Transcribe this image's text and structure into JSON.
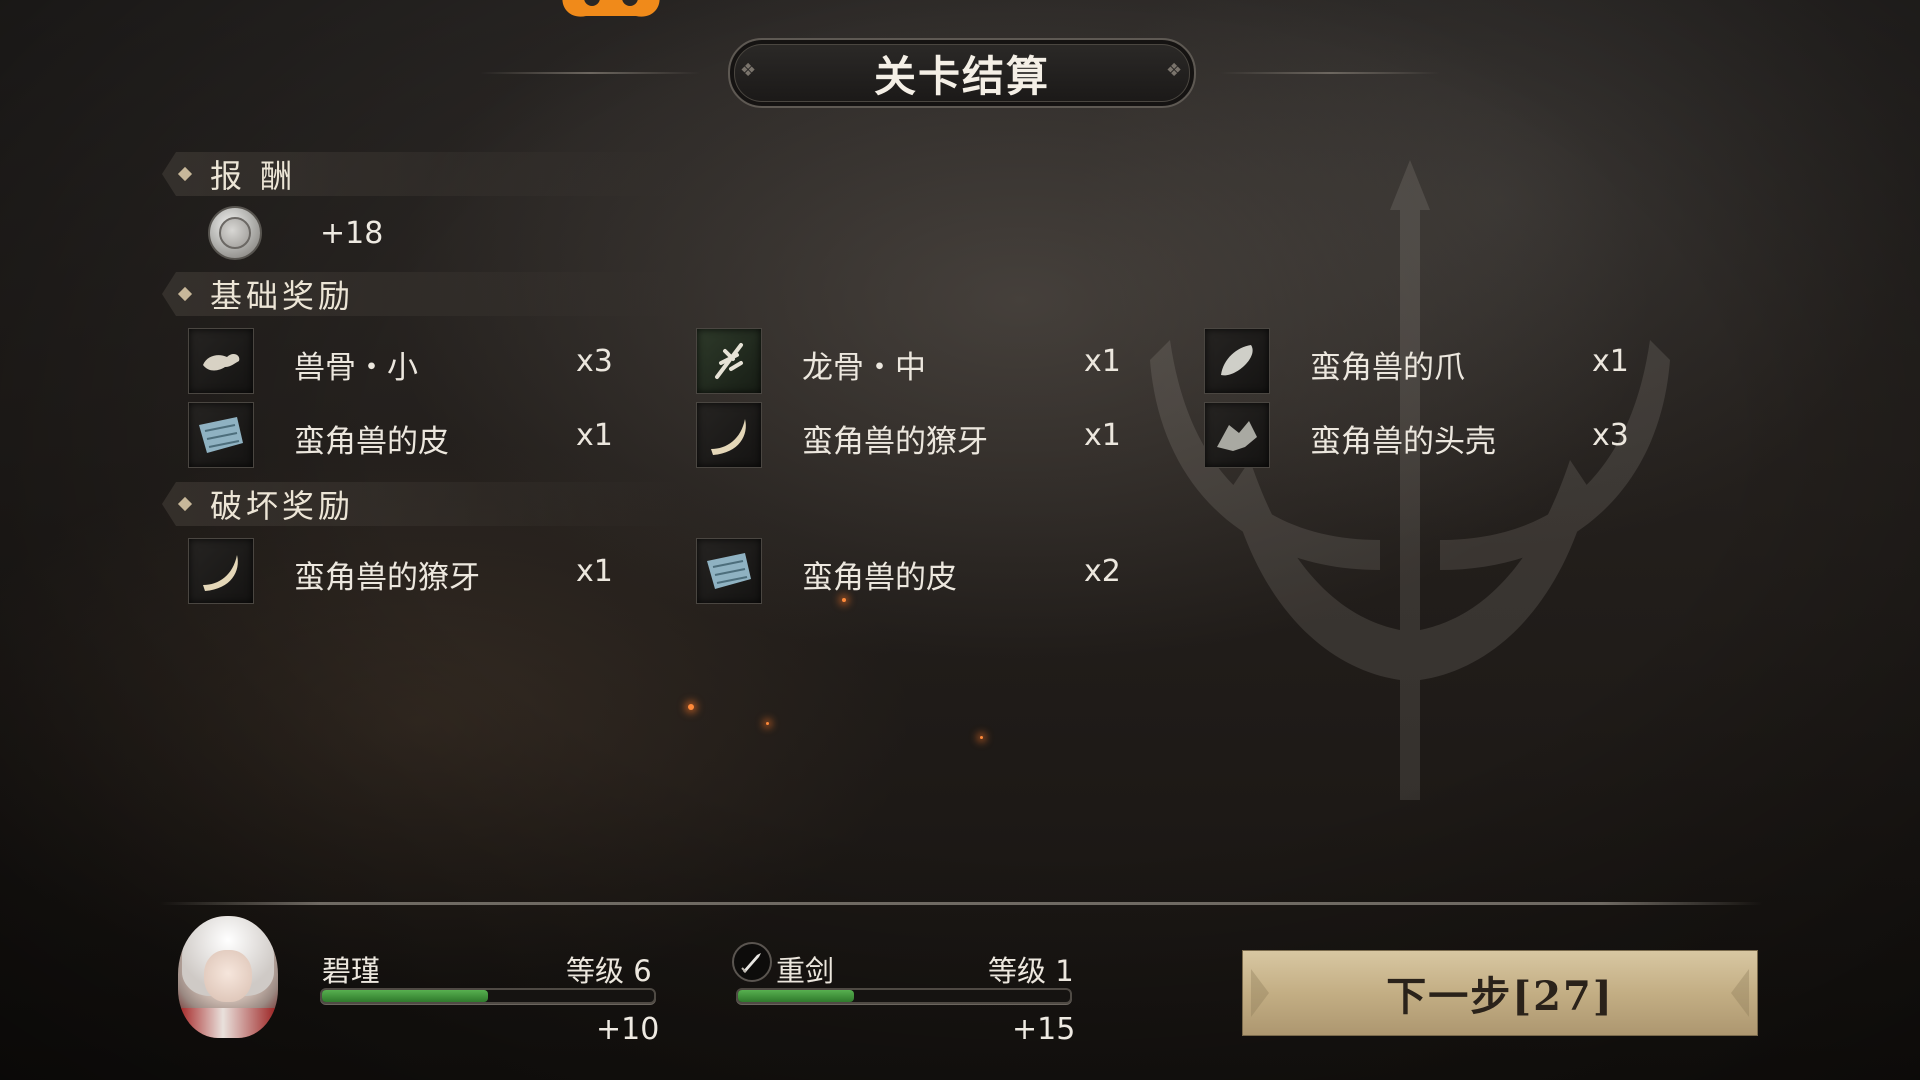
{
  "title": "关卡结算",
  "sections": {
    "reward": {
      "label": "报 酬",
      "amount": "+18",
      "currency_icon": "silver-coin-icon"
    },
    "basic": {
      "label": "基础奖励",
      "items": [
        {
          "name": "兽骨・小",
          "qty": "x3",
          "icon": "beast-bone-icon"
        },
        {
          "name": "龙骨・中",
          "qty": "x1",
          "icon": "dragon-bone-icon"
        },
        {
          "name": "蛮角兽的爪",
          "qty": "x1",
          "icon": "claw-icon"
        },
        {
          "name": "蛮角兽的皮",
          "qty": "x1",
          "icon": "hide-icon"
        },
        {
          "name": "蛮角兽的獠牙",
          "qty": "x1",
          "icon": "fang-icon"
        },
        {
          "name": "蛮角兽的头壳",
          "qty": "x3",
          "icon": "skull-shell-icon"
        }
      ]
    },
    "destruction": {
      "label": "破坏奖励",
      "items": [
        {
          "name": "蛮角兽的獠牙",
          "qty": "x1",
          "icon": "fang-icon"
        },
        {
          "name": "蛮角兽的皮",
          "qty": "x2",
          "icon": "hide-icon"
        }
      ]
    }
  },
  "character": {
    "name": "碧瑾",
    "level": "等级 6",
    "gain": "+10",
    "progress": 0.5
  },
  "weapon": {
    "name": "重剑",
    "level": "等级 1",
    "gain": "+15",
    "progress": 0.35,
    "icon": "sword-icon"
  },
  "next_button": {
    "label": "下一步[27]"
  },
  "colors": {
    "bar_fill": "#3f9a3a",
    "button_bg": "#c7b38b",
    "accent_badge": "#f08a1a"
  }
}
